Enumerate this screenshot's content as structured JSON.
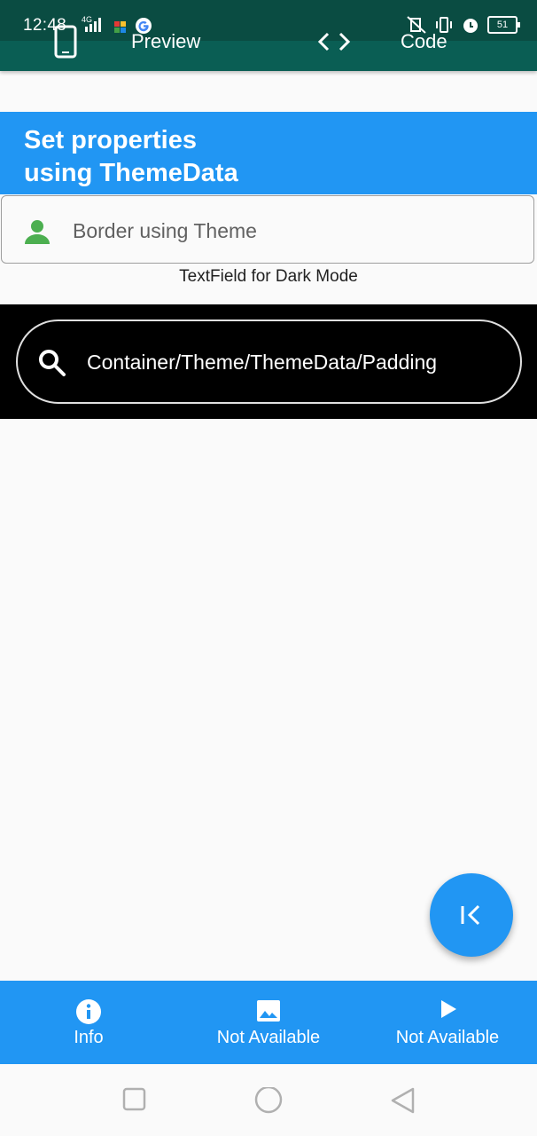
{
  "status_bar": {
    "time": "12:48",
    "network": "4G",
    "battery": "51"
  },
  "app_bar": {
    "preview_label": "Preview",
    "code_label": "Code"
  },
  "header": {
    "title": "Set properties\nusing ThemeData"
  },
  "light_field": {
    "text": "Border using Theme"
  },
  "caption": "TextField for Dark Mode",
  "dark_field": {
    "text": "Container/Theme/ThemeData/Padding"
  },
  "bottom_nav": {
    "items": [
      {
        "label": "Info",
        "icon": "info-icon"
      },
      {
        "label": "Not Available",
        "icon": "image-icon"
      },
      {
        "label": "Not Available",
        "icon": "play-icon"
      }
    ]
  },
  "colors": {
    "app_bar": "#0a5e54",
    "accent": "#2196f3",
    "person_icon": "#4caf50"
  }
}
